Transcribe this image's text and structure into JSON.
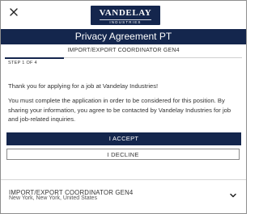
{
  "logo": {
    "line1": "VANDELAY",
    "line2": "INDUSTRIES"
  },
  "icons": {
    "close": "close-icon",
    "chevron": "chevron-down-icon"
  },
  "header": {
    "title": "Privacy Agreement PT"
  },
  "job_tab": {
    "label": "IMPORT/EXPORT COORDINATOR GEN4"
  },
  "progress": {
    "step_text": "STEP 1 OF 4",
    "current_step": 1,
    "total_steps": 4
  },
  "body": {
    "paragraph1": "Thank you for applying for a job at Vandelay Industries!",
    "paragraph2": "You must complete the application in order to be considered for this position. By sharing your information, you agree to be contacted by Vandelay Industries for job and job-related inquiries."
  },
  "actions": {
    "accept_label": "I ACCEPT",
    "decline_label": "I DECLINE"
  },
  "job_summary": {
    "title": "IMPORT/EXPORT COORDINATOR GEN4",
    "location": "New York, New York, United States"
  },
  "colors": {
    "brand": "#14264d",
    "border": "#8e8e8e"
  }
}
